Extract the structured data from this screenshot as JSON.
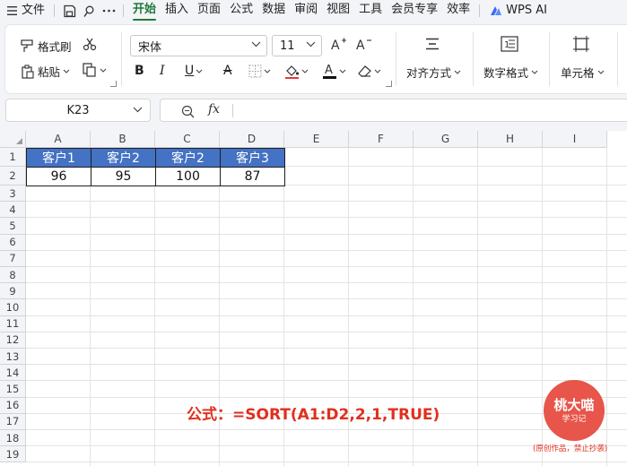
{
  "menu": {
    "file": "文件",
    "items": [
      "开始",
      "插入",
      "页面",
      "公式",
      "数据",
      "审阅",
      "视图",
      "工具",
      "会员专享",
      "效率"
    ],
    "active_index": 0,
    "wps_ai": "WPS AI"
  },
  "ribbon": {
    "format_painter": "格式刷",
    "paste": "粘贴",
    "font_name": "宋体",
    "font_size": "11",
    "align": "对齐方式",
    "number_format": "数字格式",
    "cells": "单元格"
  },
  "formula_bar": {
    "name_box": "K23",
    "fx": "fx",
    "content": ""
  },
  "sheet": {
    "columns": [
      "A",
      "B",
      "C",
      "D",
      "E",
      "F",
      "G",
      "H",
      "I"
    ],
    "rows": [
      "1",
      "2",
      "3",
      "4",
      "5",
      "6",
      "7",
      "8",
      "9",
      "10",
      "11",
      "12",
      "13",
      "14",
      "15",
      "16",
      "17",
      "18",
      "19"
    ],
    "header_row": [
      "客户1",
      "客户2",
      "客户2",
      "客户3"
    ],
    "data_row": [
      "96",
      "95",
      "100",
      "87"
    ],
    "header_fill": "#4472c4"
  },
  "annotation": {
    "formula": "公式：=SORT(A1:D2,2,1,TRUE)",
    "badge_title": "桃大喵",
    "badge_sub": "学习记",
    "badge_note": "(原创作品，禁止抄袭)",
    "color": "#e0301e"
  }
}
